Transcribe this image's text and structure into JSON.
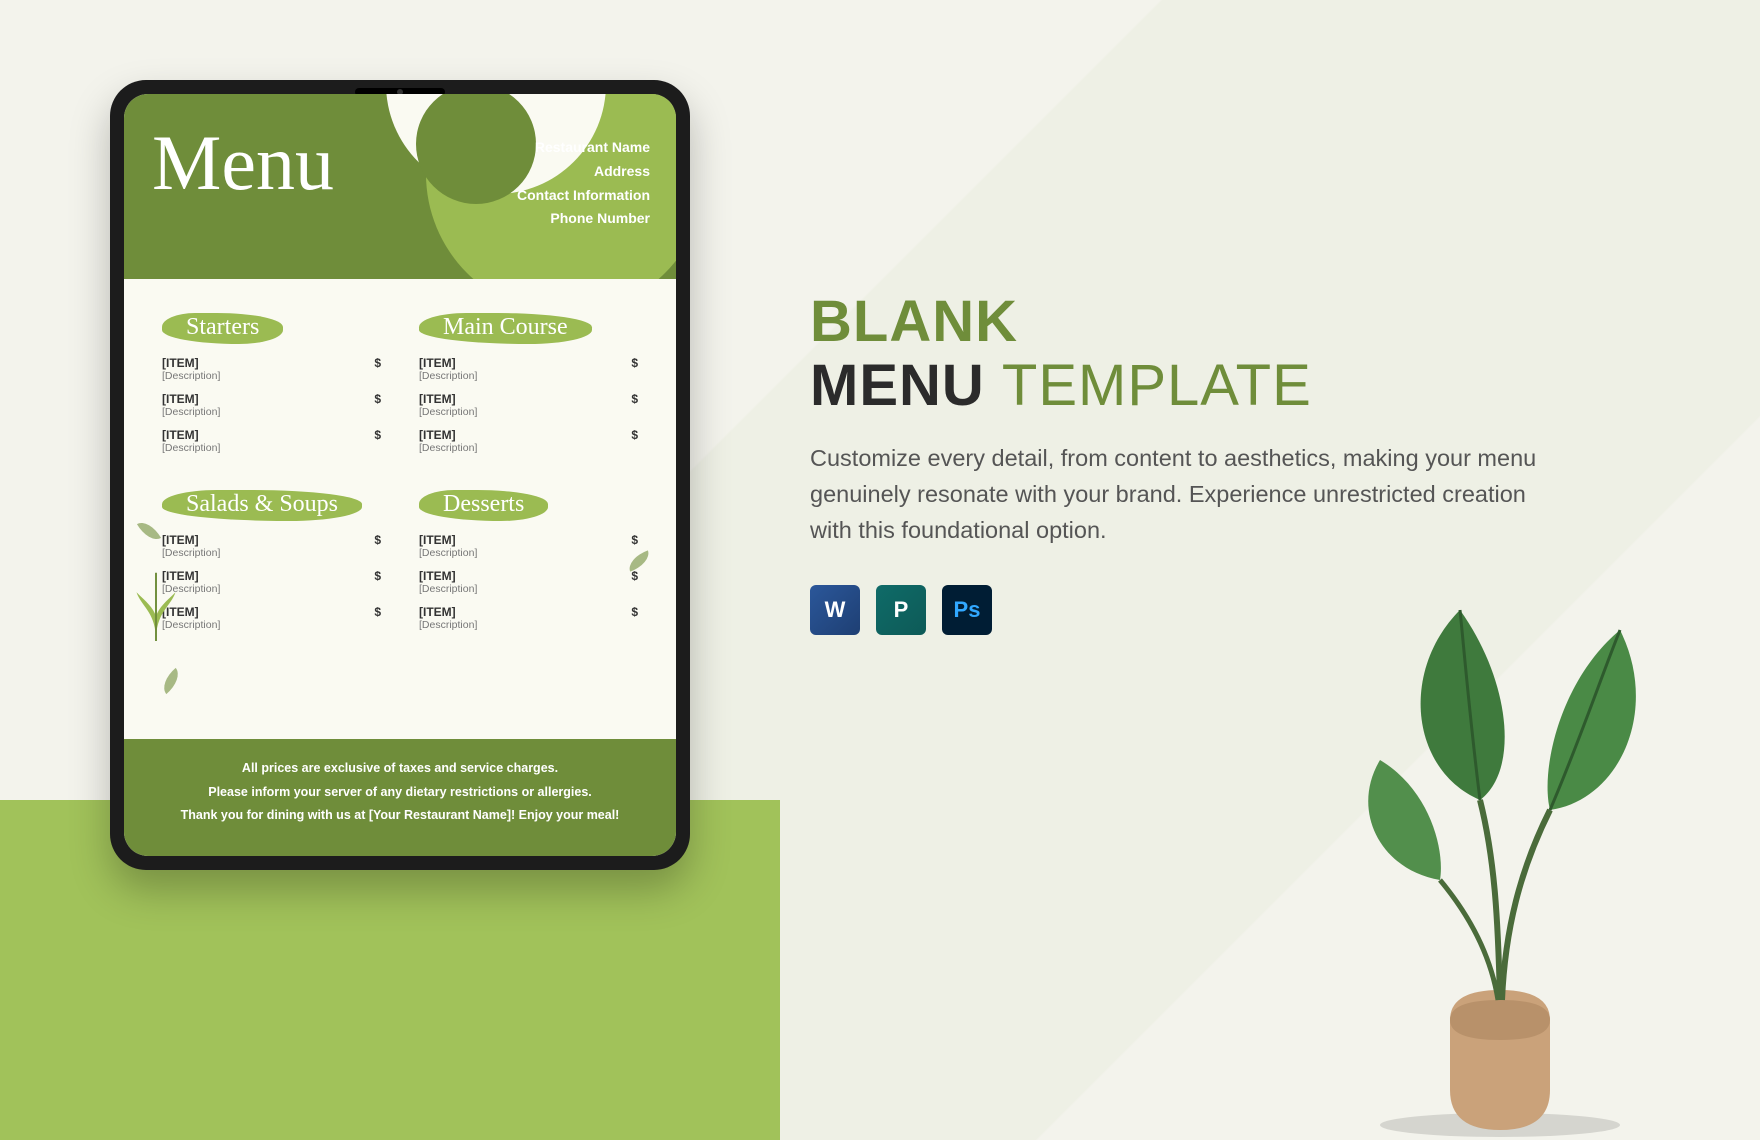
{
  "menu": {
    "title": "Menu",
    "meta": {
      "name": "Restaurant Name",
      "address": "Address",
      "contact": "Contact Information",
      "phone": "Phone Number"
    },
    "sections": [
      {
        "title": "Starters",
        "items": [
          {
            "name": "[ITEM]",
            "desc": "[Description]",
            "price": "$"
          },
          {
            "name": "[ITEM]",
            "desc": "[Description]",
            "price": "$"
          },
          {
            "name": "[ITEM]",
            "desc": "[Description]",
            "price": "$"
          }
        ]
      },
      {
        "title": "Main Course",
        "items": [
          {
            "name": "[ITEM]",
            "desc": "[Description]",
            "price": "$"
          },
          {
            "name": "[ITEM]",
            "desc": "[Description]",
            "price": "$"
          },
          {
            "name": "[ITEM]",
            "desc": "[Description]",
            "price": "$"
          }
        ]
      },
      {
        "title": "Salads & Soups",
        "items": [
          {
            "name": "[ITEM]",
            "desc": "[Description]",
            "price": "$"
          },
          {
            "name": "[ITEM]",
            "desc": "[Description]",
            "price": "$"
          },
          {
            "name": "[ITEM]",
            "desc": "[Description]",
            "price": "$"
          }
        ]
      },
      {
        "title": "Desserts",
        "items": [
          {
            "name": "[ITEM]",
            "desc": "[Description]",
            "price": "$"
          },
          {
            "name": "[ITEM]",
            "desc": "[Description]",
            "price": "$"
          },
          {
            "name": "[ITEM]",
            "desc": "[Description]",
            "price": "$"
          }
        ]
      }
    ],
    "footer": {
      "l1": "All prices are exclusive of taxes and service charges.",
      "l2": "Please inform your server of any dietary restrictions or allergies.",
      "l3": "Thank you for dining with us at [Your Restaurant Name]! Enjoy your meal!"
    }
  },
  "promo": {
    "line1": "BLANK",
    "line2a": "MENU",
    "line2b": "TEMPLATE",
    "desc": "Customize every detail, from content to aesthetics, making your menu genuinely resonate with your brand. Experience unrestricted creation with this foundational option.",
    "apps": {
      "word": "W",
      "publisher": "P",
      "photoshop": "Ps"
    }
  }
}
